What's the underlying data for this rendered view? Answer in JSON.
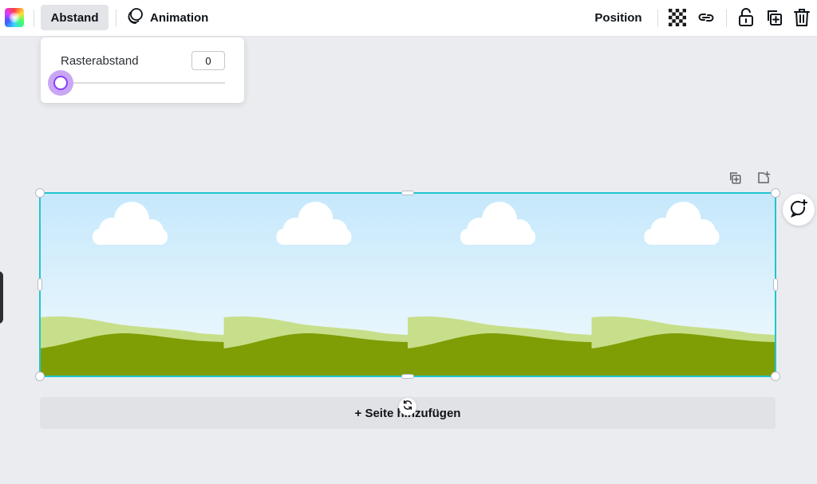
{
  "toolbar": {
    "color_icon": "color-palette-icon",
    "spacing_label": "Abstand",
    "animation_label": "Animation",
    "position_label": "Position",
    "icons": [
      "transparency-icon",
      "link-icon",
      "lock-icon",
      "duplicate-icon",
      "trash-icon"
    ]
  },
  "spacing_popover": {
    "label": "Rasterabstand",
    "value": "0",
    "slider_fraction": 0.0
  },
  "page_tools": {
    "icons": [
      "duplicate-page-icon",
      "add-page-icon"
    ]
  },
  "comment": {
    "icon": "add-comment-icon"
  },
  "add_page": {
    "label": "+ Seite hinzufügen"
  },
  "colors": {
    "accent": "#8b3dff",
    "selection": "#22c4d0",
    "sky_top": "#c5e8fb",
    "sky_bottom": "#eef8fd",
    "hill_light": "#c7df8a",
    "hill_dark": "#7f9d05"
  }
}
